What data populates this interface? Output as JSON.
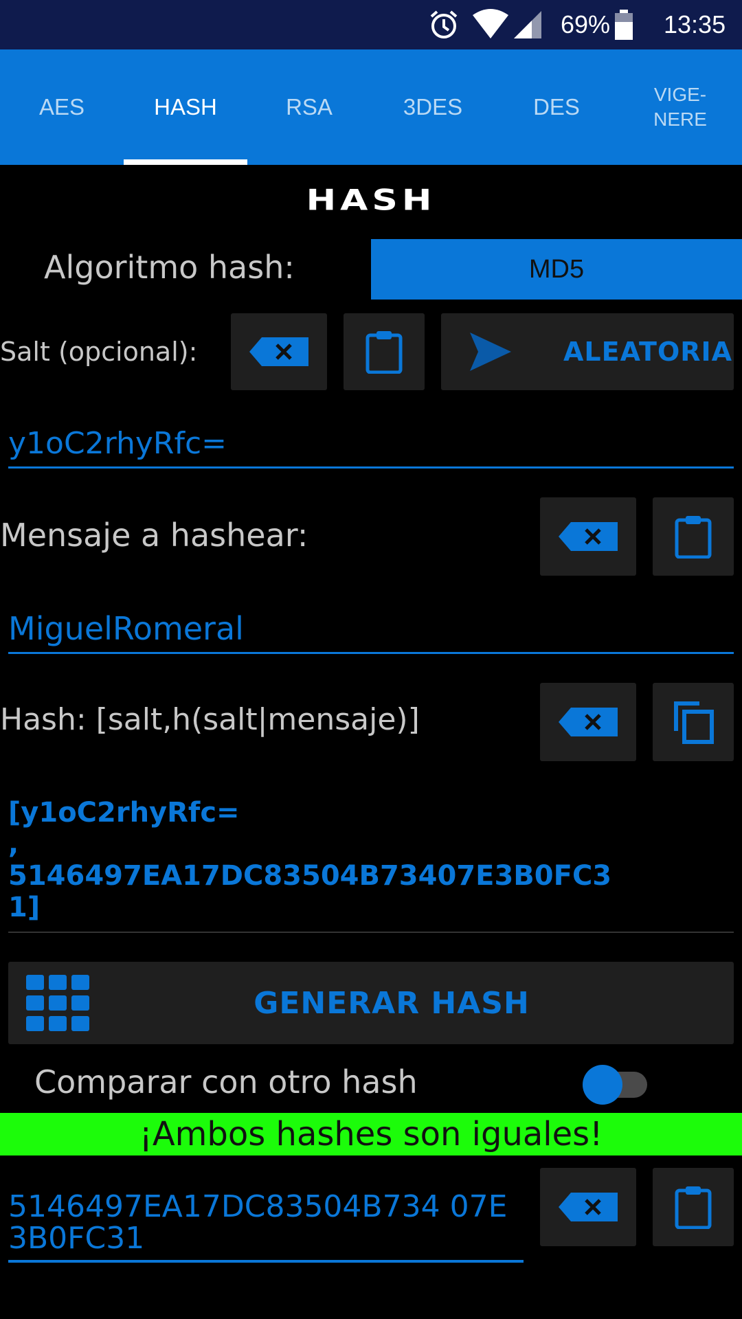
{
  "status_bar": {
    "battery": "69%",
    "time": "13:35",
    "icons": [
      "alarm-icon",
      "wifi-icon",
      "cell-signal-icon",
      "battery-icon"
    ]
  },
  "tabs": [
    {
      "label": "AES",
      "active": false
    },
    {
      "label": "HASH",
      "active": true
    },
    {
      "label": "RSA",
      "active": false
    },
    {
      "label": "3DES",
      "active": false
    },
    {
      "label": "DES",
      "active": false
    },
    {
      "label": "VIGE-\nNERE",
      "active": false
    }
  ],
  "screen": {
    "title": "HASH",
    "algorithm_label": "Algoritmo hash:",
    "algorithm_value": "MD5",
    "salt_label": "Salt (opcional):",
    "random_button": "ALEATORIA",
    "salt_value": "y1oC2rhyRfc=",
    "message_label": "Mensaje a hashear:",
    "message_value": "MiguelRomeral",
    "hash_label": "Hash: [salt,h(salt|mensaje)]",
    "hash_output": "[y1oC2rhyRfc=\n,\n5146497EA17DC83504B73407E3B0FC3\n1]",
    "generate_button": "GENERAR HASH",
    "compare_label": "Comparar con otro hash",
    "compare_enabled": true,
    "success_message": "¡Ambos hashes son iguales!",
    "compare_value": "5146497EA17DC83504B734 07E3B0FC31"
  },
  "colors": {
    "accent": "#0a77d8",
    "status_bar": "#0f1b4d",
    "success": "#1cfc0a",
    "button_bg": "#1f1f1f"
  }
}
